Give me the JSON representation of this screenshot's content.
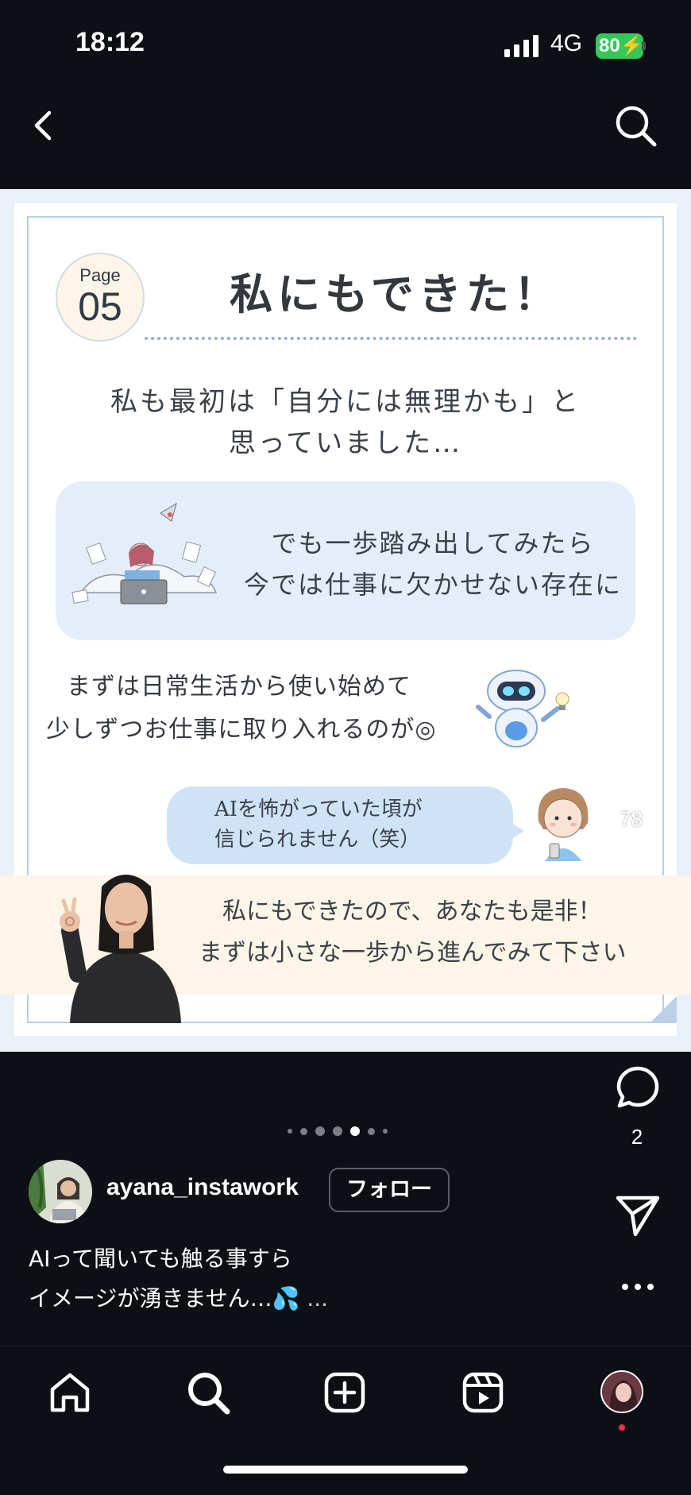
{
  "status": {
    "time": "18:12",
    "network": "4G",
    "battery": "80"
  },
  "post": {
    "page_label": "Page",
    "page_number": "05",
    "title": "私にもできた！",
    "intro_line1": "私も最初は「自分には無理かも」と",
    "intro_line2": "思っていました…",
    "box_line1": "でも一歩踏み出してみたら",
    "box_line2": "今では仕事に欠かせない存在に",
    "hand_line1": "まずは日常生活から使い始めて",
    "hand_line2": "少しずつお仕事に取り入れるのが◎",
    "bubble_line1": "AIを怖がっていた頃が",
    "bubble_line2": "信じられません（笑）",
    "band_line1": "私にもできたので、あなたも是非！",
    "band_line2": "まずは小さな一歩から進んでみて下さい"
  },
  "actions": {
    "like_count": "78",
    "comment_count": "2"
  },
  "carousel": {
    "total": 7,
    "active_index": 4
  },
  "account": {
    "username": "ayana_instawork",
    "follow_label": "フォロー"
  },
  "caption": {
    "line1": "AIって聞いても触る事すら",
    "line2": "イメージが湧きません…💦",
    "more": " ..."
  },
  "icons": {
    "back": "chevron-left-icon",
    "search": "search-icon",
    "like": "heart-icon",
    "comment": "comment-icon",
    "share": "send-icon",
    "more": "more-icon",
    "home": "home-icon",
    "explore": "search-icon",
    "create": "plus-square-icon",
    "reels": "reels-icon"
  },
  "colors": {
    "background": "#0c1015",
    "battery": "#34c759",
    "card_blue": "#e4eefb",
    "band_cream": "#fdf5e8"
  }
}
